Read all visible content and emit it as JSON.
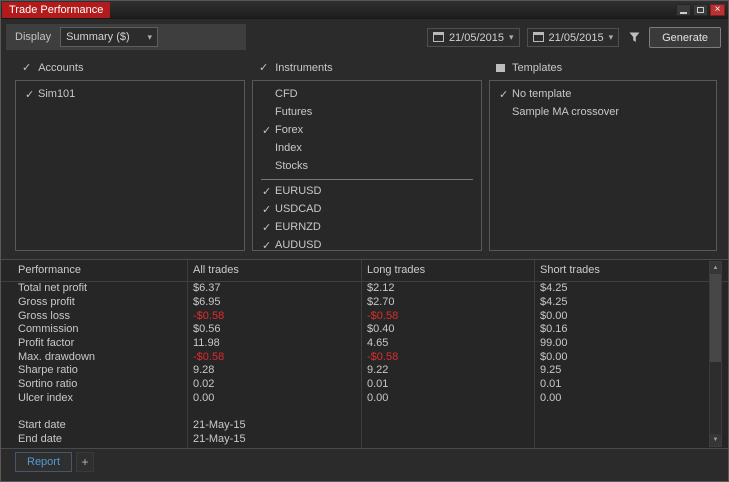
{
  "window": {
    "title": "Trade Performance"
  },
  "icons": {
    "check": "✓",
    "chevron_down": "▾",
    "scroll_up": "▲",
    "scroll_down": "▼",
    "close": "×"
  },
  "toolbar": {
    "display_label": "Display",
    "display_value": "Summary ($)",
    "date_from": "21/05/2015",
    "date_to": "21/05/2015",
    "generate_label": "Generate"
  },
  "panels": {
    "accounts": {
      "label": "Accounts",
      "checked": true,
      "items": [
        {
          "label": "Sim101",
          "checked": true
        }
      ]
    },
    "instruments": {
      "label": "Instruments",
      "checked": true,
      "types": [
        {
          "label": "CFD",
          "checked": false
        },
        {
          "label": "Futures",
          "checked": false
        },
        {
          "label": "Forex",
          "checked": true
        },
        {
          "label": "Index",
          "checked": false
        },
        {
          "label": "Stocks",
          "checked": false
        }
      ],
      "symbols": [
        {
          "label": "EURUSD",
          "checked": true
        },
        {
          "label": "USDCAD",
          "checked": true
        },
        {
          "label": "EURNZD",
          "checked": true
        },
        {
          "label": "AUDUSD",
          "checked": true
        }
      ]
    },
    "templates": {
      "label": "Templates",
      "checked": false,
      "items": [
        {
          "label": "No template",
          "checked": true
        },
        {
          "label": "Sample MA crossover",
          "checked": false
        }
      ]
    }
  },
  "table": {
    "columns": [
      "Performance",
      "All trades",
      "Long trades",
      "Short trades"
    ],
    "rows": [
      {
        "label": "Total net profit",
        "values": [
          "$6.37",
          "$2.12",
          "$4.25"
        ]
      },
      {
        "label": "Gross profit",
        "values": [
          "$6.95",
          "$2.70",
          "$4.25"
        ]
      },
      {
        "label": "Gross loss",
        "values": [
          "-$0.58",
          "-$0.58",
          "$0.00"
        ]
      },
      {
        "label": "Commission",
        "values": [
          "$0.56",
          "$0.40",
          "$0.16"
        ]
      },
      {
        "label": "Profit factor",
        "values": [
          "11.98",
          "4.65",
          "99.00"
        ]
      },
      {
        "label": "Max. drawdown",
        "values": [
          "-$0.58",
          "-$0.58",
          "$0.00"
        ]
      },
      {
        "label": "Sharpe ratio",
        "values": [
          "9.28",
          "9.22",
          "9.25"
        ]
      },
      {
        "label": "Sortino ratio",
        "values": [
          "0.02",
          "0.01",
          "0.01"
        ]
      },
      {
        "label": "Ulcer index",
        "values": [
          "0.00",
          "0.00",
          "0.00"
        ]
      },
      {
        "label": "",
        "values": [
          "",
          "",
          ""
        ]
      },
      {
        "label": "Start date",
        "values": [
          "21-May-15",
          "",
          ""
        ]
      },
      {
        "label": "End date",
        "values": [
          "21-May-15",
          "",
          ""
        ]
      }
    ]
  },
  "tabs": {
    "report": "Report",
    "add": "+"
  },
  "colors": {
    "negative": "#dd2c2c",
    "tab_accent": "#4f9cd9",
    "title_highlight": "#b11b1b"
  }
}
